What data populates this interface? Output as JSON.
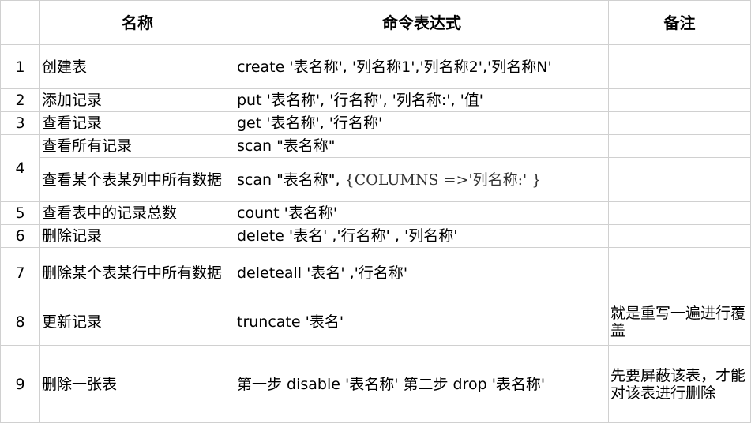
{
  "headers": {
    "index": "",
    "name": "名称",
    "command": "命令表达式",
    "note": "备注"
  },
  "rows": [
    {
      "idx": "1",
      "name": "创建表",
      "command": "create '表名称', '列名称1','列名称2','列名称N'",
      "note": ""
    },
    {
      "idx": "2",
      "name": "添加记录",
      "command": "put '表名称', '行名称', '列名称:', '值'",
      "note": ""
    },
    {
      "idx": "3",
      "name": "查看记录",
      "command": "get '表名称', '行名称'",
      "note": ""
    },
    {
      "idx": "4",
      "name": "查看所有记录",
      "command": "scan \"表名称\"",
      "note": ""
    },
    {
      "idx": "",
      "name": "查看某个表某列中所有数据",
      "command_a": "scan \"表名称\", ",
      "command_b": "{COLUMNS  =>'列名称:' }",
      "note": ""
    },
    {
      "idx": "5",
      "name": "查看表中的记录总数",
      "command": "count  '表名称'",
      "note": ""
    },
    {
      "idx": "6",
      "name": "删除记录",
      "command": "delete  '表名' ,'行名称' , '列名称'",
      "note": ""
    },
    {
      "idx": "7",
      "name": "删除某个表某行中所有数据",
      "command": "deleteall  '表名' ,'行名称'",
      "note": ""
    },
    {
      "idx": "8",
      "name": "更新记录",
      "command": "truncate  '表名'",
      "note": "就是重写一遍进行覆盖"
    },
    {
      "idx": "9",
      "name": "删除一张表",
      "command": "第一步 disable '表名称' 第二步  drop '表名称'",
      "note": "先要屏蔽该表，才能对该表进行删除"
    }
  ]
}
